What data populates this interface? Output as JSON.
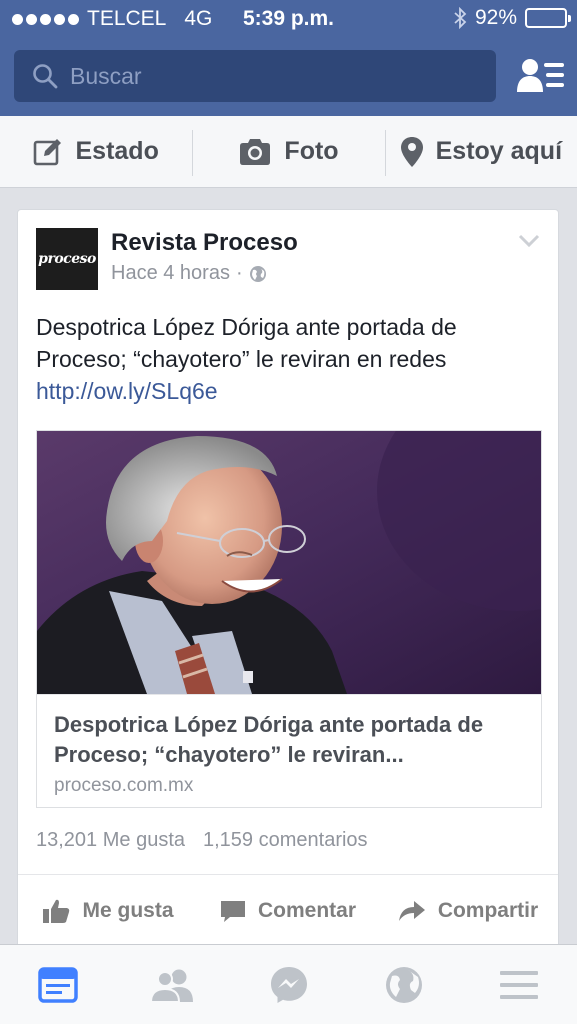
{
  "status_bar": {
    "carrier": "TELCEL",
    "network": "4G",
    "time": "5:39 p.m.",
    "battery_percent": "92%",
    "battery_level": 0.92
  },
  "search": {
    "placeholder": "Buscar"
  },
  "composer": {
    "items": [
      {
        "label": "Estado",
        "icon": "edit-icon"
      },
      {
        "label": "Foto",
        "icon": "camera-icon"
      },
      {
        "label": "Estoy aquí",
        "icon": "location-pin-icon"
      }
    ]
  },
  "post": {
    "avatar_text": "proceso",
    "author": "Revista Proceso",
    "time": "Hace 4 horas",
    "separator": "·",
    "privacy_icon": "globe-icon",
    "text": "Despotrica López Dóriga ante portada de Proceso; “chayotero” le reviran en redes",
    "link": "http://ow.ly/SLq6e",
    "link_preview": {
      "title": "Despotrica López Dóriga ante portada de Proceso; “chayotero” le reviran...",
      "domain": "proceso.com.mx"
    },
    "likes": "13,201 Me gusta",
    "comments": "1,159 comentarios"
  },
  "actions": {
    "like": "Me gusta",
    "comment": "Comentar",
    "share": "Compartir"
  },
  "tabbar": {
    "active": "news-feed",
    "tabs": [
      "news-feed-icon",
      "friend-requests-icon",
      "messenger-icon",
      "notifications-globe-icon",
      "menu-icon"
    ]
  },
  "colors": {
    "header": "#4a66a0",
    "search_bg": "#2f4778",
    "link": "#3b5998",
    "active_tab": "#4080ff",
    "inactive_tab": "#bec3c9"
  }
}
